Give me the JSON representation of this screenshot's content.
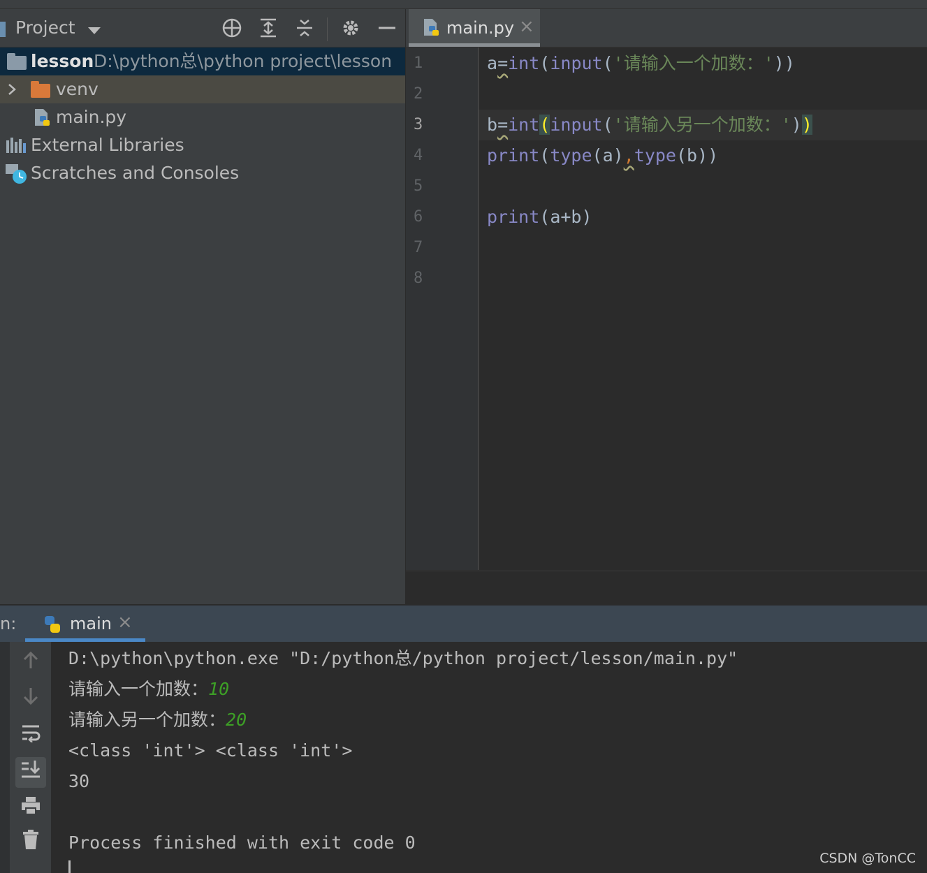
{
  "project_panel": {
    "title": "Project",
    "tree": {
      "root_name": "lesson",
      "root_path": "D:\\python总\\python project\\lesson",
      "venv": "venv",
      "main_file": "main.py",
      "external_libraries": "External Libraries",
      "scratches": "Scratches and Consoles"
    }
  },
  "editor": {
    "tab_label": "main.py",
    "close_glyph": "×",
    "line_numbers": [
      "1",
      "2",
      "3",
      "4",
      "5",
      "6",
      "7",
      "8"
    ],
    "lines": {
      "l1": {
        "var": "a",
        "eq": "=",
        "fn1": "int",
        "p1": "(",
        "fn2": "input",
        "p2": "(",
        "str": "'请输入一个加数：'",
        "close": "))"
      },
      "l3": {
        "var": "b",
        "eq": "=",
        "fn1": "int",
        "p1": "(",
        "fn2": "input",
        "p2": "(",
        "str": "'请输入另一个加数：'",
        "close1": ")",
        "close2": ")"
      },
      "l4": {
        "fn1": "print",
        "p1": "(",
        "fn2": "type",
        "arg1": "(a)",
        "comma": ",",
        "fn3": "type",
        "arg2": "(b))"
      },
      "l6": {
        "fn1": "print",
        "args": "(a+b)"
      }
    }
  },
  "run_panel": {
    "label": "n:",
    "tab_label": "main",
    "close_glyph": "×",
    "output": {
      "cmd": "D:\\python\\python.exe \"D:/python总/python project/lesson/main.py\"",
      "prompt1": "请输入一个加数：",
      "input1": "10",
      "prompt2": "请输入另一个加数：",
      "input2": "20",
      "types": "<class 'int'> <class 'int'>",
      "result": "30",
      "finish": "Process finished with exit code 0"
    }
  },
  "watermark": "CSDN @TonCC",
  "colors": {
    "keyword": "#8888c6",
    "string": "#6a8759",
    "input_green": "#3d9f26",
    "selection": "#0d293e"
  }
}
